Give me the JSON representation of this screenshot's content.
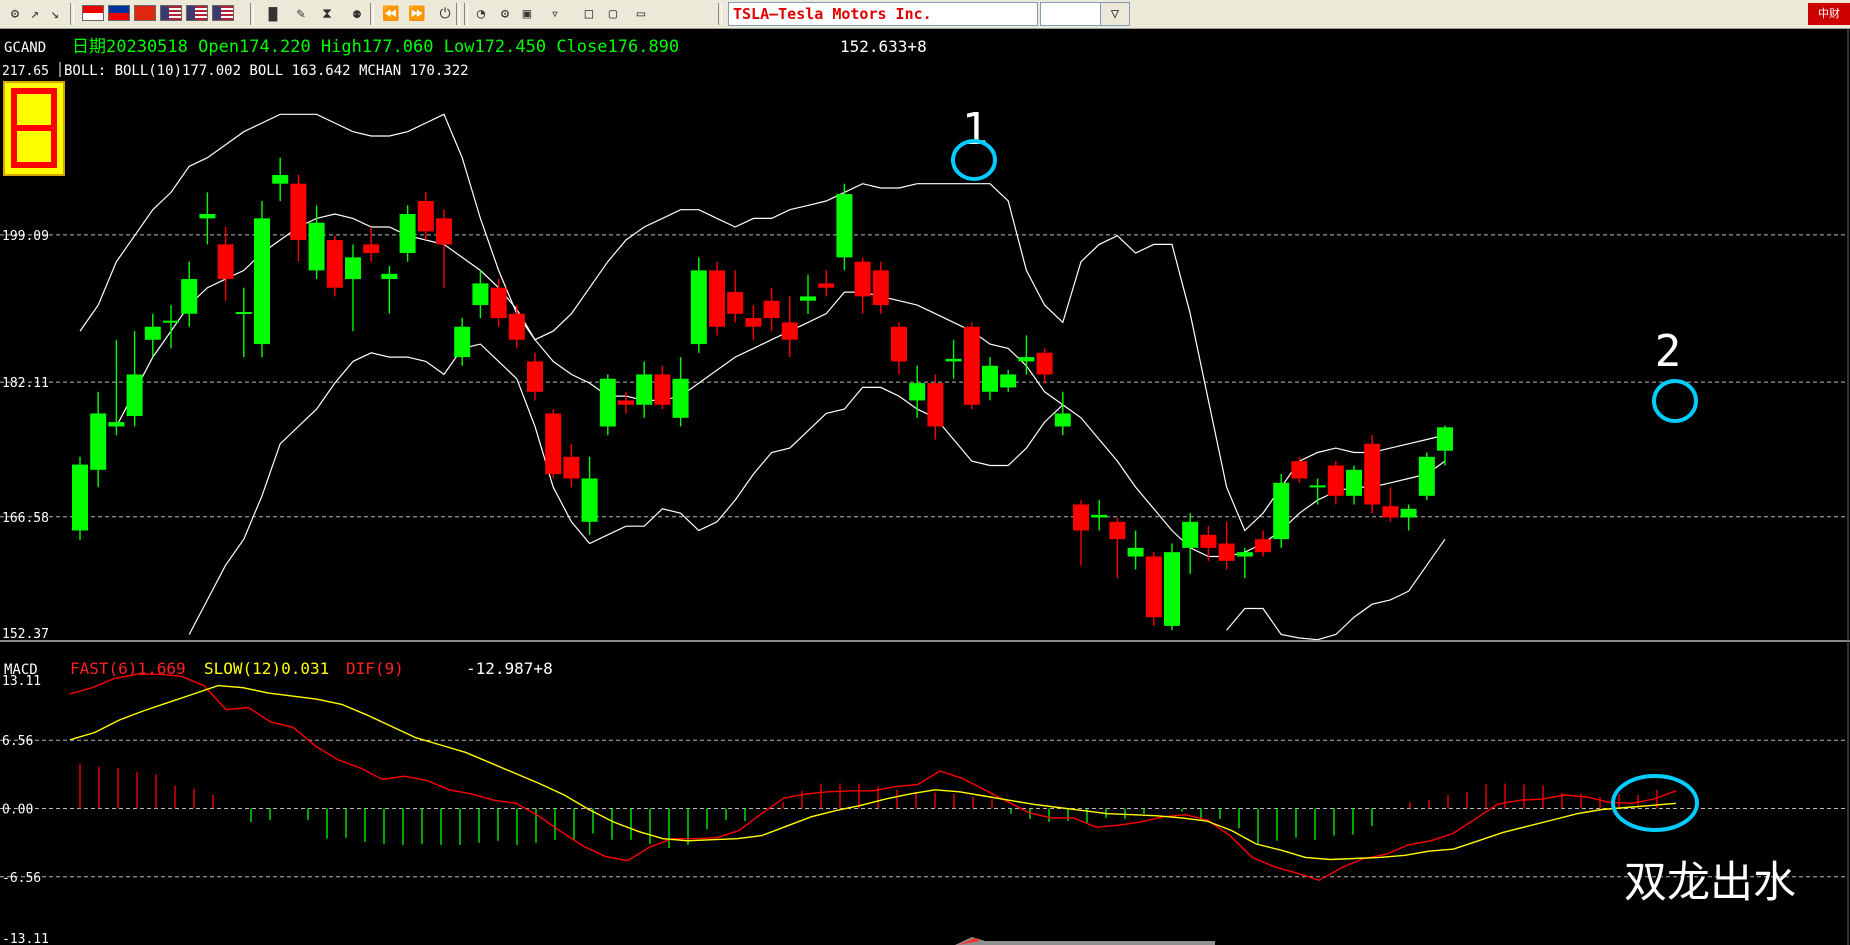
{
  "toolbar": {
    "symbol": "TSLA—Tesla Motors Inc.",
    "icons": [
      "open-icon",
      "up-arrow-icon",
      "down-arrow-icon",
      "flag-sg-icon",
      "flag-my-icon",
      "flag-hk-icon",
      "flag-us-icon",
      "flag-us-icon",
      "flag-us-icon",
      "bar-chart-icon",
      "edit-icon",
      "hourglass-icon",
      "network-icon",
      "rewind-icon",
      "fast-forward-icon",
      "power-icon",
      "rss-icon",
      "gear-icon",
      "window-icon",
      "cart-icon",
      "folder-icon",
      "folder-open-icon",
      "monitor-icon"
    ],
    "dropdown_glyph": "▽",
    "logo_text": "中财"
  },
  "colors": {
    "up": "#00ff00",
    "down": "#ff0000",
    "bands": "#ffffff",
    "fast": "#ff0000",
    "slow": "#ffff00",
    "highlight": "#00ccff",
    "header_green": "#00ff00",
    "grid": "#cccccc"
  },
  "main_panel": {
    "label": "GCAND",
    "info": "日期20230518  Open174.220  High177.060  Low172.450  Close176.890",
    "cursor_value": "152.633+8",
    "legend": "BOLL: BOLL(10)177.002  BOLL 163.642  MCHAN 170.322",
    "top_value": "217.65",
    "y_ticks": [
      "199.09",
      "182.11",
      "166.58",
      "152.37"
    ],
    "annotations": [
      "1",
      "2"
    ]
  },
  "macd_panel": {
    "label": "MACD",
    "fast_label": "FAST(6)1.669",
    "slow_label": "SLOW(12)0.031",
    "dif_label": "DIF(9)",
    "cursor_value": "-12.987+8",
    "y_ticks": [
      "13.11",
      "6.56",
      "0.00",
      "-6.56",
      "-13.11"
    ],
    "caption": "双龙出水"
  },
  "chart_data": [
    {
      "type": "candlestick",
      "ylim": [
        152.37,
        217.65
      ],
      "y_ticks": [
        199.09,
        182.11,
        166.58,
        152.37
      ],
      "grid": true,
      "candles": [
        {
          "o": 165.0,
          "c": 172.6,
          "h": 173.5,
          "l": 163.9
        },
        {
          "o": 172.0,
          "c": 178.5,
          "h": 181.0,
          "l": 170.0
        },
        {
          "o": 177.0,
          "c": 177.5,
          "h": 187.0,
          "l": 176.0
        },
        {
          "o": 178.2,
          "c": 183.0,
          "h": 188.0,
          "l": 177.0
        },
        {
          "o": 187.0,
          "c": 188.5,
          "h": 190.0,
          "l": 185.0
        },
        {
          "o": 189.0,
          "c": 189.2,
          "h": 191.0,
          "l": 186.0
        },
        {
          "o": 190.0,
          "c": 194.0,
          "h": 196.0,
          "l": 188.5
        },
        {
          "o": 201.0,
          "c": 201.5,
          "h": 204.0,
          "l": 198.0
        },
        {
          "o": 198.0,
          "c": 194.0,
          "h": 200.0,
          "l": 191.5
        },
        {
          "o": 190.0,
          "c": 190.2,
          "h": 193.0,
          "l": 185.0
        },
        {
          "o": 186.5,
          "c": 201.0,
          "h": 203.0,
          "l": 185.0
        },
        {
          "o": 205.0,
          "c": 206.0,
          "h": 208.0,
          "l": 203.0
        },
        {
          "o": 205.0,
          "c": 198.5,
          "h": 206.0,
          "l": 196.0
        },
        {
          "o": 195.0,
          "c": 200.5,
          "h": 202.5,
          "l": 194.0
        },
        {
          "o": 198.5,
          "c": 193.0,
          "h": 199.0,
          "l": 192.0
        },
        {
          "o": 194.0,
          "c": 196.5,
          "h": 198.0,
          "l": 188.0
        },
        {
          "o": 198.0,
          "c": 197.0,
          "h": 200.0,
          "l": 196.0
        },
        {
          "o": 194.0,
          "c": 194.6,
          "h": 195.5,
          "l": 190.0
        },
        {
          "o": 197.0,
          "c": 201.5,
          "h": 202.5,
          "l": 196.0
        },
        {
          "o": 203.0,
          "c": 199.5,
          "h": 204.0,
          "l": 198.5
        },
        {
          "o": 201.0,
          "c": 198.0,
          "h": 202.0,
          "l": 193.0
        },
        {
          "o": 185.0,
          "c": 188.5,
          "h": 189.5,
          "l": 184.0
        },
        {
          "o": 191.0,
          "c": 193.5,
          "h": 195.0,
          "l": 189.5
        },
        {
          "o": 193.0,
          "c": 189.5,
          "h": 194.0,
          "l": 188.5
        },
        {
          "o": 190.0,
          "c": 187.0,
          "h": 191.0,
          "l": 186.0
        },
        {
          "o": 184.5,
          "c": 181.0,
          "h": 185.5,
          "l": 180.0
        },
        {
          "o": 178.5,
          "c": 171.5,
          "h": 179.0,
          "l": 171.0
        },
        {
          "o": 173.5,
          "c": 171.0,
          "h": 175.0,
          "l": 170.0
        },
        {
          "o": 166.0,
          "c": 171.0,
          "h": 173.5,
          "l": 164.5
        },
        {
          "o": 177.0,
          "c": 182.5,
          "h": 183.0,
          "l": 176.0
        },
        {
          "o": 180.0,
          "c": 179.5,
          "h": 181.0,
          "l": 178.5
        },
        {
          "o": 179.5,
          "c": 183.0,
          "h": 184.5,
          "l": 178.0
        },
        {
          "o": 183.0,
          "c": 179.5,
          "h": 184.0,
          "l": 179.0
        },
        {
          "o": 178.0,
          "c": 182.5,
          "h": 185.0,
          "l": 177.0
        },
        {
          "o": 186.5,
          "c": 195.0,
          "h": 196.5,
          "l": 185.5
        },
        {
          "o": 195.0,
          "c": 188.5,
          "h": 196.0,
          "l": 187.5
        },
        {
          "o": 192.5,
          "c": 190.0,
          "h": 195.0,
          "l": 189.0
        },
        {
          "o": 189.5,
          "c": 188.5,
          "h": 191.0,
          "l": 187.0
        },
        {
          "o": 191.5,
          "c": 189.5,
          "h": 193.0,
          "l": 188.0
        },
        {
          "o": 189.0,
          "c": 187.0,
          "h": 192.0,
          "l": 185.0
        },
        {
          "o": 191.5,
          "c": 192.0,
          "h": 194.5,
          "l": 190.0
        },
        {
          "o": 193.5,
          "c": 193.0,
          "h": 195.0,
          "l": 192.0
        },
        {
          "o": 196.5,
          "c": 203.8,
          "h": 205.0,
          "l": 195.0
        },
        {
          "o": 196.0,
          "c": 192.0,
          "h": 196.5,
          "l": 190.0
        },
        {
          "o": 195.0,
          "c": 191.0,
          "h": 196.0,
          "l": 190.0
        },
        {
          "o": 188.5,
          "c": 184.5,
          "h": 189.0,
          "l": 183.0
        },
        {
          "o": 180.0,
          "c": 182.0,
          "h": 184.0,
          "l": 178.0
        },
        {
          "o": 182.0,
          "c": 177.0,
          "h": 183.0,
          "l": 175.5
        },
        {
          "o": 184.5,
          "c": 184.8,
          "h": 187.0,
          "l": 182.5
        },
        {
          "o": 188.5,
          "c": 179.5,
          "h": 189.0,
          "l": 179.0
        },
        {
          "o": 181.0,
          "c": 184.0,
          "h": 185.0,
          "l": 180.0
        },
        {
          "o": 181.5,
          "c": 183.0,
          "h": 183.5,
          "l": 181.0
        },
        {
          "o": 184.5,
          "c": 185.0,
          "h": 187.5,
          "l": 183.0
        },
        {
          "o": 185.5,
          "c": 183.0,
          "h": 186.0,
          "l": 182.0
        },
        {
          "o": 177.0,
          "c": 178.5,
          "h": 181.0,
          "l": 176.0
        },
        {
          "o": 168.0,
          "c": 165.0,
          "h": 168.5,
          "l": 161.0
        },
        {
          "o": 166.5,
          "c": 166.8,
          "h": 168.5,
          "l": 165.0
        },
        {
          "o": 166.0,
          "c": 164.0,
          "h": 166.5,
          "l": 159.5
        },
        {
          "o": 162.0,
          "c": 163.0,
          "h": 165.0,
          "l": 160.5
        },
        {
          "o": 162.0,
          "c": 155.0,
          "h": 162.5,
          "l": 154.0
        },
        {
          "o": 154.0,
          "c": 162.5,
          "h": 163.5,
          "l": 153.5
        },
        {
          "o": 163.0,
          "c": 166.0,
          "h": 167.0,
          "l": 160.0
        },
        {
          "o": 164.5,
          "c": 163.0,
          "h": 165.5,
          "l": 161.5
        },
        {
          "o": 163.5,
          "c": 161.5,
          "h": 166.0,
          "l": 160.5
        },
        {
          "o": 162.0,
          "c": 162.5,
          "h": 163.0,
          "l": 159.5
        },
        {
          "o": 164.0,
          "c": 162.5,
          "h": 165.0,
          "l": 162.0
        },
        {
          "o": 164.0,
          "c": 170.5,
          "h": 171.5,
          "l": 163.0
        },
        {
          "o": 173.0,
          "c": 171.0,
          "h": 173.5,
          "l": 170.5
        },
        {
          "o": 170.0,
          "c": 170.2,
          "h": 171.0,
          "l": 168.0
        },
        {
          "o": 172.5,
          "c": 169.0,
          "h": 173.0,
          "l": 168.0
        },
        {
          "o": 169.0,
          "c": 172.0,
          "h": 172.5,
          "l": 168.0
        },
        {
          "o": 175.0,
          "c": 168.0,
          "h": 176.0,
          "l": 167.0
        },
        {
          "o": 167.8,
          "c": 166.5,
          "h": 170.0,
          "l": 166.0
        },
        {
          "o": 166.5,
          "c": 167.5,
          "h": 168.0,
          "l": 165.0
        },
        {
          "o": 169.0,
          "c": 173.5,
          "h": 174.0,
          "l": 168.5
        },
        {
          "o": 174.2,
          "c": 176.9,
          "h": 177.1,
          "l": 172.5
        }
      ],
      "bands": {
        "upper": [
          188.0,
          191.0,
          196.0,
          199.0,
          202.0,
          204.0,
          207.0,
          208.0,
          209.5,
          211.0,
          212.0,
          213.0,
          213.0,
          213.0,
          212.0,
          211.0,
          210.5,
          210.5,
          211.0,
          212.0,
          213.0,
          208.0,
          201.0,
          195.0,
          190.0,
          187.0,
          188.0,
          190.0,
          193.0,
          196.0,
          198.5,
          200.0,
          201.0,
          202.0,
          202.0,
          201.0,
          200.0,
          201.0,
          201.0,
          202.0,
          202.5,
          203.0,
          204.0,
          205.0,
          204.5,
          204.5,
          205.0,
          205.0,
          205.0,
          205.0,
          205.0,
          203.0,
          195.0,
          191.0,
          189.0,
          196.0,
          198.0,
          199.0,
          197.0,
          198.0,
          198.0,
          190.0,
          180.0,
          170.0,
          165.0,
          167.0,
          170.0,
          173.0,
          174.0,
          174.5,
          174.0,
          174.0,
          174.5,
          175.0,
          175.5,
          176.0
        ],
        "middle": [
          null,
          null,
          177.0,
          181.0,
          185.0,
          188.0,
          191.0,
          193.0,
          194.0,
          195.0,
          197.0,
          198.5,
          200.0,
          201.0,
          201.5,
          201.0,
          200.0,
          200.0,
          199.0,
          198.5,
          198.0,
          196.5,
          195.0,
          193.0,
          190.5,
          187.0,
          184.5,
          183.0,
          182.0,
          180.5,
          180.5,
          180.0,
          180.0,
          180.5,
          182.0,
          183.5,
          185.0,
          186.0,
          187.0,
          188.0,
          189.0,
          190.0,
          192.5,
          192.5,
          192.0,
          191.5,
          191.0,
          190.0,
          189.0,
          188.0,
          186.5,
          186.0,
          184.0,
          181.0,
          179.5,
          178.0,
          175.5,
          173.0,
          170.0,
          167.5,
          165.0,
          163.0,
          162.0,
          162.0,
          162.5,
          163.5,
          165.0,
          167.0,
          168.5,
          169.5,
          170.0,
          170.0,
          170.5,
          171.0,
          171.5,
          173.0
        ],
        "lower": [
          null,
          null,
          null,
          null,
          null,
          null,
          153.0,
          157.0,
          161.0,
          164.0,
          169.0,
          175.0,
          177.0,
          179.0,
          182.0,
          184.5,
          185.5,
          185.0,
          185.0,
          184.5,
          183.0,
          186.0,
          186.5,
          184.5,
          182.5,
          177.0,
          170.0,
          166.0,
          163.5,
          164.5,
          165.5,
          165.5,
          167.5,
          167.0,
          165.0,
          166.0,
          168.5,
          171.5,
          174.0,
          174.5,
          176.5,
          178.5,
          179.0,
          181.5,
          181.5,
          180.5,
          179.0,
          178.0,
          175.5,
          173.0,
          172.5,
          172.5,
          174.5,
          177.5,
          179.5,
          null,
          null,
          null,
          null,
          null,
          null,
          null,
          null,
          153.5,
          156.0,
          156.0,
          153.0,
          152.6,
          152.4,
          153.0,
          155.0,
          156.5,
          157.0,
          158.0,
          161.0,
          164.0
        ]
      }
    },
    {
      "type": "line",
      "ylim": [
        -13.11,
        13.11
      ],
      "y_ticks": [
        13.11,
        6.56,
        0.0,
        -6.56,
        -13.11
      ],
      "series": [
        {
          "name": "FAST(6)",
          "values": [
            11.0,
            11.6,
            12.5,
            12.9,
            12.9,
            12.7,
            11.8,
            9.5,
            9.7,
            8.3,
            7.8,
            6.0,
            4.7,
            3.9,
            2.8,
            3.1,
            2.7,
            1.8,
            1.4,
            0.8,
            0.5,
            -0.7,
            -2.2,
            -3.6,
            -4.6,
            -5.0,
            -3.7,
            -2.9,
            -2.9,
            -2.8,
            -2.1,
            -0.5,
            1.0,
            1.4,
            1.6,
            1.7,
            1.7,
            2.1,
            2.3,
            3.6,
            2.9,
            1.8,
            0.7,
            -0.4,
            -0.9,
            -0.9,
            -1.8,
            -1.6,
            -1.3,
            -0.8,
            -0.6,
            -1.1,
            -2.6,
            -4.7,
            -5.6,
            -6.2,
            -6.9,
            -5.7,
            -4.8,
            -4.4,
            -3.5,
            -3.1,
            -2.4,
            -1.0,
            0.4,
            0.8,
            0.9,
            1.3,
            1.1,
            0.6,
            0.5,
            0.9,
            1.7
          ]
        },
        {
          "name": "SLOW(12)",
          "values": [
            6.6,
            7.3,
            8.5,
            9.4,
            10.2,
            11.0,
            11.8,
            11.6,
            11.1,
            10.8,
            10.5,
            10.0,
            9.0,
            7.9,
            6.8,
            6.1,
            5.4,
            4.4,
            3.4,
            2.4,
            1.3,
            -0.1,
            -1.3,
            -2.2,
            -2.9,
            -3.1,
            -3.0,
            -2.9,
            -2.6,
            -1.7,
            -0.8,
            -0.2,
            0.3,
            0.9,
            1.4,
            1.8,
            1.6,
            1.2,
            0.8,
            0.4,
            0.1,
            -0.2,
            -0.5,
            -0.6,
            -0.7,
            -0.9,
            -1.2,
            -2.1,
            -3.4,
            -4.0,
            -4.7,
            -4.9,
            -4.8,
            -4.7,
            -4.5,
            -4.1,
            -3.9,
            -3.1,
            -2.3,
            -1.7,
            -1.1,
            -0.5,
            -0.1,
            0.1,
            0.3,
            0.5
          ]
        }
      ],
      "histogram": [
        4.3,
        4.0,
        3.9,
        3.5,
        3.3,
        2.2,
        1.9,
        1.3,
        0,
        -1.3,
        -1.1,
        0,
        -1.1,
        -2.9,
        -2.8,
        -3.2,
        -3.4,
        -3.5,
        -3.4,
        -3.5,
        -3.5,
        -3.3,
        -3.1,
        -3.5,
        -3.3,
        -3.0,
        -3.0,
        -2.4,
        -3.0,
        -3.0,
        -3.4,
        -3.8,
        -3.5,
        -2.0,
        -1.1,
        -1.2,
        0,
        0.6,
        1.7,
        2.4,
        2.4,
        2.4,
        2.1,
        1.8,
        1.6,
        1.5,
        1.4,
        1.1,
        0.9,
        -0.5,
        -1.0,
        -1.3,
        -1.2,
        -1.4,
        -0.9,
        -1.0,
        -0.5,
        0,
        -0.3,
        -1.1,
        -1.0,
        -1.9,
        -3.4,
        -3.1,
        -2.8,
        -3.0,
        -2.6,
        -2.5,
        -1.7,
        0,
        0.6,
        0.8,
        1.3,
        1.6,
        2.3,
        2.4,
        2.3,
        2.2,
        1.5,
        1.4,
        1.1,
        1.4,
        1.3,
        1.8
      ]
    }
  ]
}
